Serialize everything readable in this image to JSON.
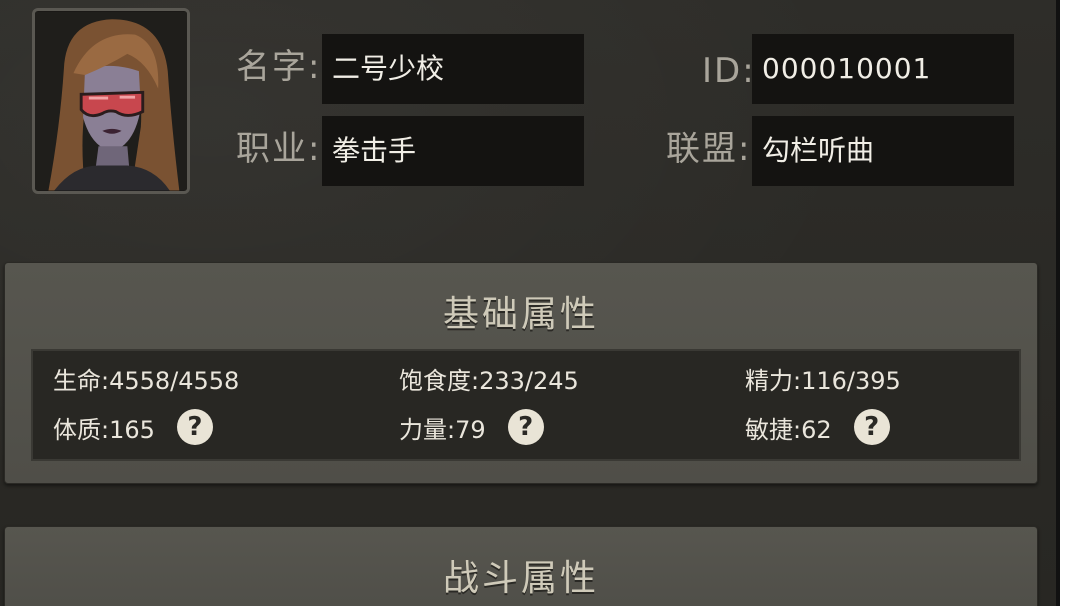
{
  "profile": {
    "name_label": "名字:",
    "name_value": "二号少校",
    "id_label": "ID:",
    "id_value": "000010001",
    "job_label": "职业:",
    "job_value": "拳击手",
    "alliance_label": "联盟:",
    "alliance_value": "勾栏听曲"
  },
  "basic_attributes": {
    "title": "基础属性",
    "life": "生命:4558/4558",
    "satiety": "饱食度:233/245",
    "energy": "精力:116/395",
    "constitution": "体质:165",
    "strength": "力量:79",
    "agility": "敏捷:62",
    "help_glyph": "?"
  },
  "combat_attributes": {
    "title": "战斗属性"
  }
}
